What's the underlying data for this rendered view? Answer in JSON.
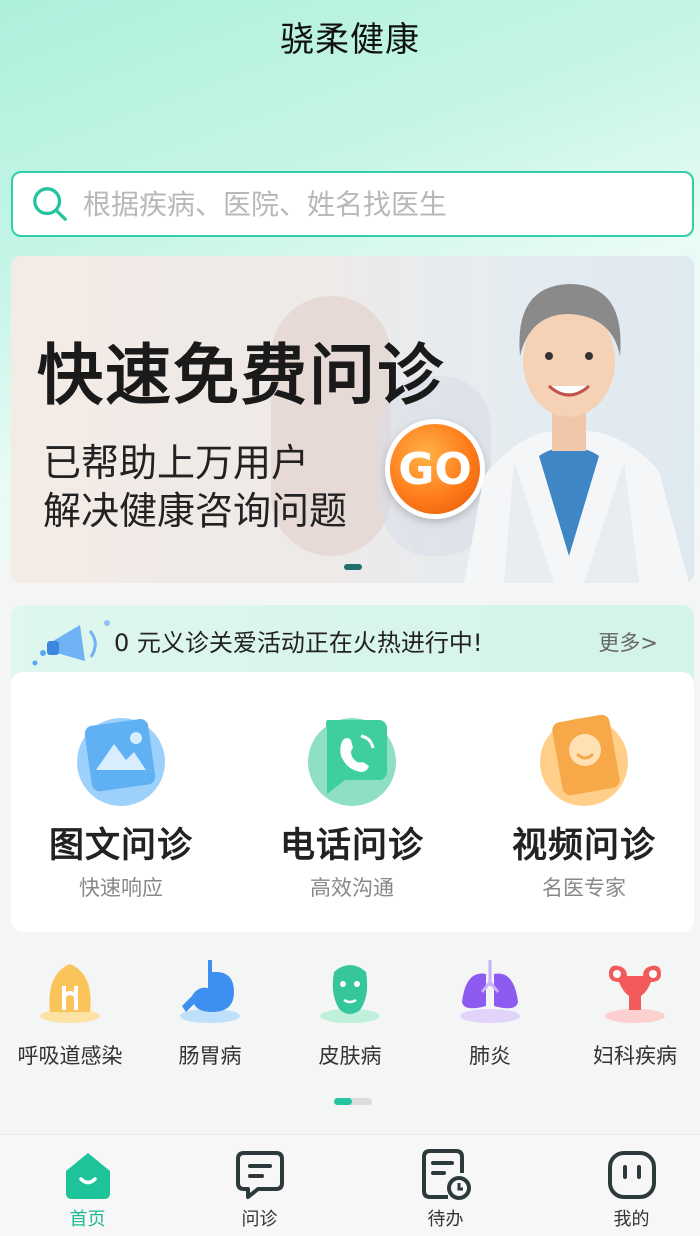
{
  "header": {
    "title": "骁柔健康"
  },
  "search": {
    "placeholder": "根据疾病、医院、姓名找医生",
    "value": ""
  },
  "banner": {
    "headline": "快速免费问诊",
    "line1": "已帮助上万用户",
    "line2": "解决健康咨询问题",
    "go_label": "GO"
  },
  "notice": {
    "text": "0 元义诊关爱活动正在火热进行中!",
    "more": "更多>"
  },
  "services": [
    {
      "name": "图文问诊",
      "desc": "快速响应",
      "icon": "image-text-consult-icon"
    },
    {
      "name": "电话问诊",
      "desc": "高效沟通",
      "icon": "phone-consult-icon"
    },
    {
      "name": "视频问诊",
      "desc": "名医专家",
      "icon": "video-consult-icon"
    }
  ],
  "categories": [
    {
      "label": "呼吸道感染",
      "icon": "respiratory-icon"
    },
    {
      "label": "肠胃病",
      "icon": "stomach-icon"
    },
    {
      "label": "皮肤病",
      "icon": "skin-mask-icon"
    },
    {
      "label": "肺炎",
      "icon": "lungs-icon"
    },
    {
      "label": "妇科疾病",
      "icon": "uterus-icon"
    }
  ],
  "tabbar": [
    {
      "label": "首页",
      "icon": "home-icon",
      "active": true
    },
    {
      "label": "问诊",
      "icon": "chat-icon",
      "active": false
    },
    {
      "label": "待办",
      "icon": "todo-clock-icon",
      "active": false
    },
    {
      "label": "我的",
      "icon": "profile-icon",
      "active": false
    }
  ],
  "colors": {
    "accent": "#25c3a0",
    "search_border": "#32cfa7",
    "go_orange": "#ff7b1a"
  }
}
